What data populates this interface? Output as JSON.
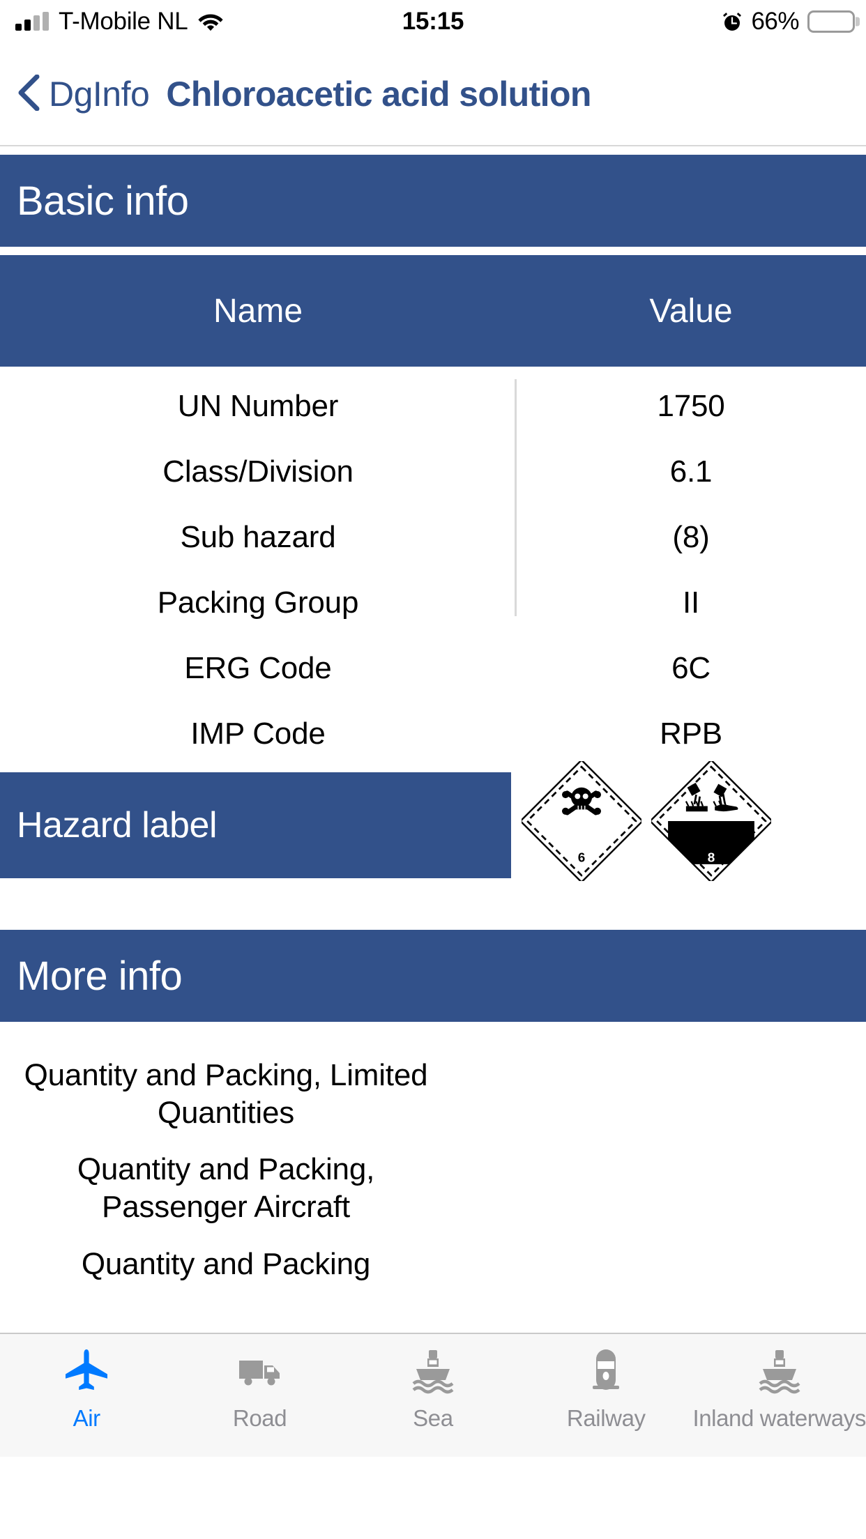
{
  "status_bar": {
    "carrier": "T-Mobile NL",
    "signal_icon": "cellular-signal-icon",
    "wifi_icon": "wifi-icon",
    "time": "15:15",
    "alarm_icon": "alarm-clock-icon",
    "battery_percent": "66%",
    "battery_level": 66,
    "battery_icon": "battery-icon"
  },
  "nav_bar": {
    "back_icon": "chevron-left-icon",
    "back_label": "DgInfo",
    "title": "Chloroacetic acid solution"
  },
  "basic_info": {
    "section_title": "Basic info",
    "columns": {
      "name": "Name",
      "value": "Value"
    },
    "rows": [
      {
        "name": "UN Number",
        "value": "1750"
      },
      {
        "name": "Class/Division",
        "value": "6.1"
      },
      {
        "name": "Sub hazard",
        "value": "(8)"
      },
      {
        "name": "Packing Group",
        "value": "II"
      },
      {
        "name": "ERG Code",
        "value": "6C"
      },
      {
        "name": "IMP Code",
        "value": "RPB"
      }
    ],
    "hazard_label": {
      "label": "Hazard label",
      "placards": [
        {
          "icon": "toxic-placard-icon",
          "class_number": "6",
          "description": "skull-and-crossbones toxic diamond"
        },
        {
          "icon": "corrosive-placard-icon",
          "class_number": "8",
          "description": "corrosive acid diamond"
        }
      ]
    }
  },
  "more_info": {
    "section_title": "More info",
    "items": [
      "Quantity and Packing, Limited Quantities",
      "Quantity and Packing, Passenger Aircraft",
      "Quantity and Packing"
    ]
  },
  "tab_bar": {
    "active_index": 0,
    "tabs": [
      {
        "label": "Air",
        "icon": "airplane-icon"
      },
      {
        "label": "Road",
        "icon": "truck-icon"
      },
      {
        "label": "Sea",
        "icon": "ship-icon"
      },
      {
        "label": "Railway",
        "icon": "train-icon"
      },
      {
        "label": "Inland waterways",
        "icon": "barge-icon"
      }
    ]
  },
  "colors": {
    "brand_navy": "#32518A",
    "accent_blue": "#007AFF",
    "tab_inactive": "#8E8E93",
    "tab_bar_bg": "#F7F7F7"
  }
}
